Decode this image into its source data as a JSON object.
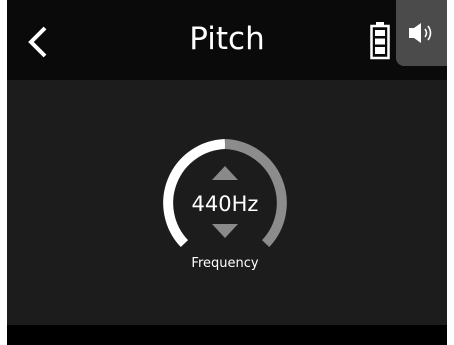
{
  "header": {
    "title": "Pitch",
    "back_icon": "chevron-left-icon",
    "battery_icon": "battery-icon",
    "speaker_icon": "speaker-icon"
  },
  "pitch_control": {
    "value": "440Hz",
    "label": "Frequency",
    "up_icon": "triangle-up-icon",
    "down_icon": "triangle-down-icon"
  },
  "colors": {
    "screen_background": "#000000",
    "panel_background": "#1c1c1c",
    "speaker_tab": "#4b4b4b",
    "dial_active": "#ffffff",
    "dial_inactive": "#8c8c8c",
    "arrow": "#8a8a8a",
    "text": "#ffffff"
  }
}
